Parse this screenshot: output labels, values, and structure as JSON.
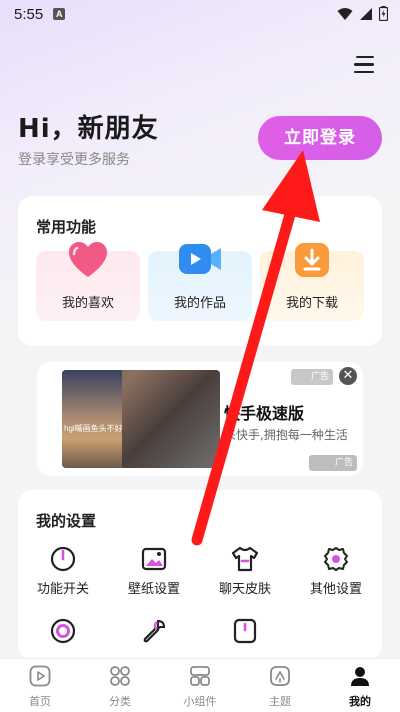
{
  "status_bar": {
    "time": "5:55",
    "notif_letter": "A"
  },
  "header": {
    "greeting": "Hi，新朋友",
    "subtitle": "登录享受更多服务",
    "login_label": "立即登录"
  },
  "common_functions": {
    "title": "常用功能",
    "items": [
      {
        "label": "我的喜欢",
        "icon": "heart-icon"
      },
      {
        "label": "我的作品",
        "icon": "video-camera-icon"
      },
      {
        "label": "我的下载",
        "icon": "download-icon"
      }
    ]
  },
  "ad": {
    "badge_top": "广告",
    "close": "✕",
    "title": "快手极速版",
    "subtitle": "来快手,拥抱每一种生活",
    "badge_bottom": "广告",
    "thumb_caption": "hgi嘴画鱼头不好"
  },
  "settings": {
    "title": "我的设置",
    "items": [
      {
        "label": "功能开关",
        "icon": "power-icon"
      },
      {
        "label": "壁纸设置",
        "icon": "wallpaper-icon"
      },
      {
        "label": "聊天皮肤",
        "icon": "tshirt-icon"
      },
      {
        "label": "其他设置",
        "icon": "gear-icon"
      },
      {
        "label": "",
        "icon": "circle-icon"
      },
      {
        "label": "",
        "icon": "wrench-icon"
      },
      {
        "label": "",
        "icon": "phone-icon"
      }
    ]
  },
  "tabbar": {
    "tabs": [
      {
        "label": "首页",
        "icon": "play-icon"
      },
      {
        "label": "分类",
        "icon": "grid-icon"
      },
      {
        "label": "小组件",
        "icon": "widget-icon"
      },
      {
        "label": "主题",
        "icon": "theme-icon"
      },
      {
        "label": "我的",
        "icon": "user-icon",
        "active": true
      }
    ]
  },
  "colors": {
    "accent": "#dc5fe8",
    "arrow": "#ff1a1a"
  }
}
